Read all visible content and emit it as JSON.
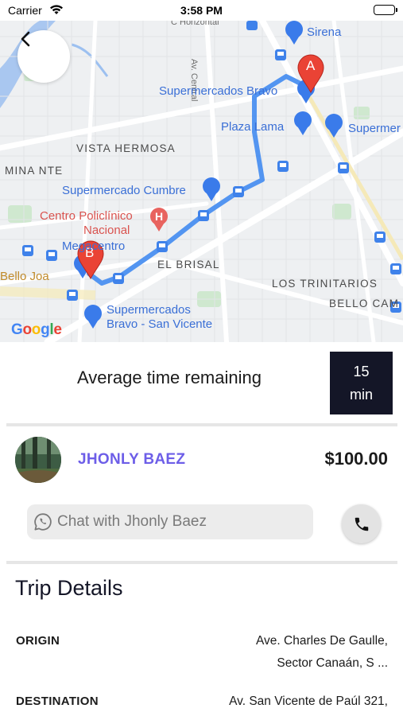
{
  "status_bar": {
    "carrier": "Carrier",
    "time": "3:58 PM"
  },
  "map": {
    "labels": {
      "horizontal_road": "C Horizontal",
      "central_road": "Av. Central",
      "sirena": "Sirena",
      "supermercados_bravo": "Supermercados Bravo",
      "plaza_lama": "Plaza Lama",
      "supermer": "Supermer",
      "vista_hermosa": "VISTA HERMOSA",
      "mina_nte": "MINA NTE",
      "supermercado_cumbre": "Supermercado Cumbre",
      "centro_policlinico_1": "Centro Policlínico",
      "centro_policlinico_2": "Nacional",
      "megacentro": "Megacentro",
      "el_brisal": "EL BRISAL",
      "los_trinitarios": "LOS TRINITARIOS",
      "bello_joa": "Bello Joa",
      "bello_cam": "BELLO CAM",
      "bravo_sv_1": "Supermercados",
      "bravo_sv_2": "Bravo - San Vicente"
    },
    "marker_a": "A",
    "marker_b": "B",
    "hospital_glyph": "H",
    "google_logo": [
      "G",
      "o",
      "o",
      "g",
      "l",
      "e"
    ],
    "google_colors": [
      "#4285F4",
      "#EA4335",
      "#FBBC05",
      "#4285F4",
      "#34A853",
      "#EA4335"
    ],
    "route_color": "#4a8ff0",
    "pin_color": "#ea4335",
    "poi_color": "#3a6fd6"
  },
  "eta": {
    "label": "Average time remaining",
    "value": "15",
    "unit": "min"
  },
  "driver": {
    "name": "JHONLY BAEZ",
    "fare": "$100.00",
    "name_color": "#6d5ee8"
  },
  "chat": {
    "placeholder": "Chat with Jhonly Baez"
  },
  "trip": {
    "title": "Trip Details",
    "origin_label": "ORIGIN",
    "origin_line1": "Ave. Charles De Gaulle,",
    "origin_line2": "Sector Canaán, S ...",
    "destination_label": "DESTINATION",
    "destination_line1": "Av. San Vicente de Paúl 321,"
  },
  "icons": {
    "back": "back-arrow-icon",
    "wifi": "wifi-icon",
    "battery": "battery-icon",
    "whatsapp": "whatsapp-icon",
    "phone": "phone-icon"
  }
}
